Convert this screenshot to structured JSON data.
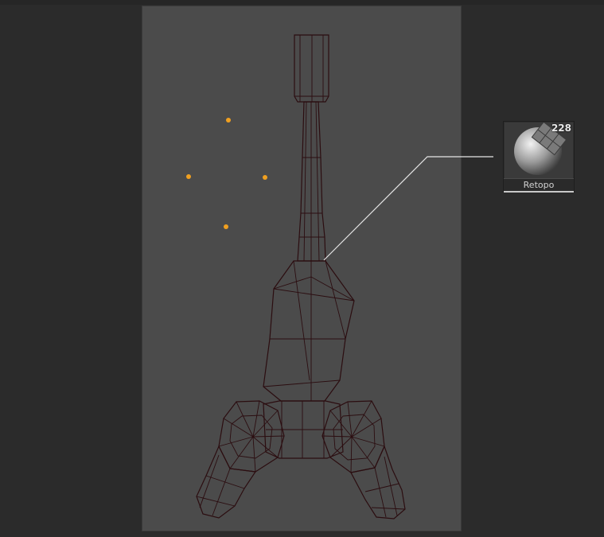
{
  "brush": {
    "label": "Retopo",
    "count": "228",
    "icon": "retopo-brush-icon"
  },
  "colors": {
    "mesh_fill": "#7a2a2e",
    "mesh_wire": "#2b0d10",
    "point": "#f0a020",
    "canvas": "#4b4b4b",
    "background": "#2b2b2b"
  }
}
